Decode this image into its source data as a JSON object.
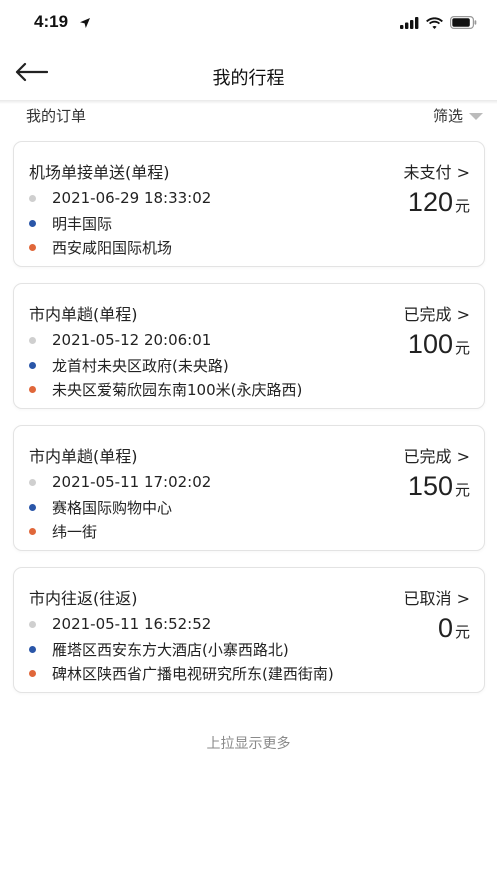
{
  "status_bar": {
    "time": "4:19"
  },
  "nav": {
    "title": "我的行程"
  },
  "filter": {
    "title": "我的订单",
    "button": "筛选"
  },
  "orders": [
    {
      "title": "机场单接单送(单程)",
      "status": "未支付 >",
      "time": "2021-06-29 18:33:02",
      "from": "明丰国际",
      "to": "西安咸阳国际机场",
      "price": "120",
      "unit": "元"
    },
    {
      "title": "市内单趟(单程)",
      "status": "已完成 >",
      "time": "2021-05-12 20:06:01",
      "from": "龙首村未央区政府(未央路)",
      "to": "未央区爱菊欣园东南100米(永庆路西)",
      "price": "100",
      "unit": "元"
    },
    {
      "title": "市内单趟(单程)",
      "status": "已完成 >",
      "time": "2021-05-11 17:02:02",
      "from": "赛格国际购物中心",
      "to": "纬一街",
      "price": "150",
      "unit": "元"
    },
    {
      "title": "市内往返(往返)",
      "status": "已取消 >",
      "time": "2021-05-11 16:52:52",
      "from": "雁塔区西安东方大酒店(小寨西路北)",
      "to": "碑林区陕西省广播电视研究所东(建西街南)",
      "price": "0",
      "unit": "元"
    }
  ],
  "footer": {
    "load_more": "上拉显示更多"
  },
  "colors": {
    "dot_time": "#cfcfcf",
    "dot_from": "#2a56a8",
    "dot_to": "#e0673a"
  }
}
